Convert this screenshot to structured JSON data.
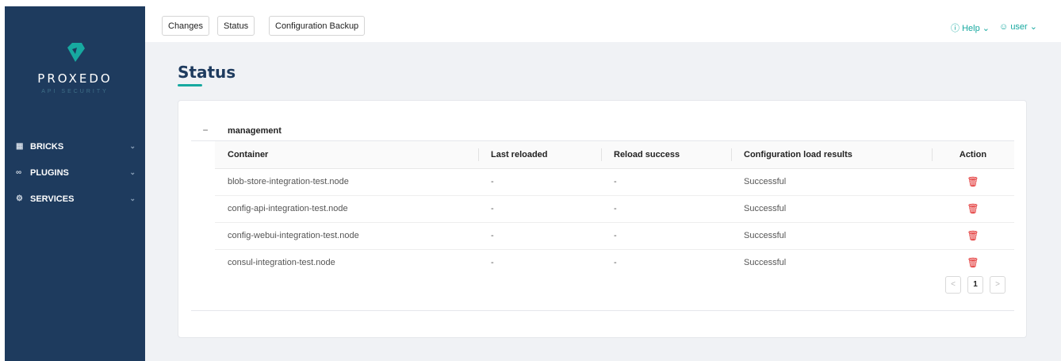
{
  "brand": {
    "name": "PROXEDO",
    "tagline": "API SECURITY",
    "logo_color": "#17a9a0"
  },
  "sidebar": {
    "items": [
      {
        "label": "BRICKS",
        "icon": "grid-icon"
      },
      {
        "label": "PLUGINS",
        "icon": "plug-icon"
      },
      {
        "label": "SERVICES",
        "icon": "gear-icon"
      }
    ]
  },
  "topbar": {
    "tabs": [
      {
        "label": "Changes"
      },
      {
        "label": "Status"
      },
      {
        "label": "Configuration Backup"
      }
    ],
    "help_label": "Help",
    "user_label": "user"
  },
  "page": {
    "title": "Status"
  },
  "group": {
    "name": "management",
    "toggle": "−"
  },
  "table": {
    "headers": [
      "Container",
      "Last reloaded",
      "Reload success",
      "Configuration load results",
      "Action"
    ],
    "rows": [
      {
        "container": "blob-store-integration-test.node",
        "last_reloaded": "-",
        "reload_success": "-",
        "result": "Successful"
      },
      {
        "container": "config-api-integration-test.node",
        "last_reloaded": "-",
        "reload_success": "-",
        "result": "Successful"
      },
      {
        "container": "config-webui-integration-test.node",
        "last_reloaded": "-",
        "reload_success": "-",
        "result": "Successful"
      },
      {
        "container": "consul-integration-test.node",
        "last_reloaded": "-",
        "reload_success": "-",
        "result": "Successful"
      }
    ]
  },
  "pagination": {
    "current_page": "1",
    "prev": "<",
    "next": ">"
  },
  "colors": {
    "sidebar_bg": "#1e3b5e",
    "accent": "#17a9a0",
    "danger": "#e02424"
  }
}
